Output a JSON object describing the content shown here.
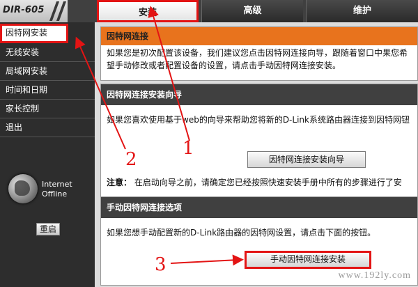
{
  "logo": {
    "model": "DIR-605"
  },
  "nav_tabs": [
    "安装",
    "高级",
    "维护"
  ],
  "sidebar": {
    "items": [
      "因特网安装",
      "无线安装",
      "局域网安装",
      "时间和日期",
      "家长控制",
      "退出"
    ],
    "status": {
      "line1": "Internet",
      "line2": "Offline"
    },
    "reboot_label": "重启"
  },
  "main": {
    "intro": {
      "title": "因特网连接",
      "text": "如果您是初次配置该设备，我们建议您点击因特网连接向导，跟随着窗口中果您希望手动修改或者配置设备的设置，请点击手动因特网连接安装。"
    },
    "wizard": {
      "title": "因特网连接安装向导",
      "text": "如果您喜欢使用基于web的向导来帮助您将新的D-Link系统路由器连接到因特网钮",
      "button_label": "因特网连接安装向导",
      "note_label": "注意：",
      "note_text": "在启动向导之前，请确定您已经按照快速安装手册中所有的步骤进行了安"
    },
    "manual": {
      "title": "手动因特网连接选项",
      "text": "如果您想手动配置新的D-Link路由器的因特网设置，请点击下面的按钮。",
      "button_label": "手动因特网连接安装"
    }
  },
  "annotations": [
    "1",
    "2",
    "3"
  ],
  "watermark": "www.192ly.com",
  "colors": {
    "highlight_red": "#e31414",
    "intro_header": "#e8731d",
    "dark_bar": "#404040"
  }
}
